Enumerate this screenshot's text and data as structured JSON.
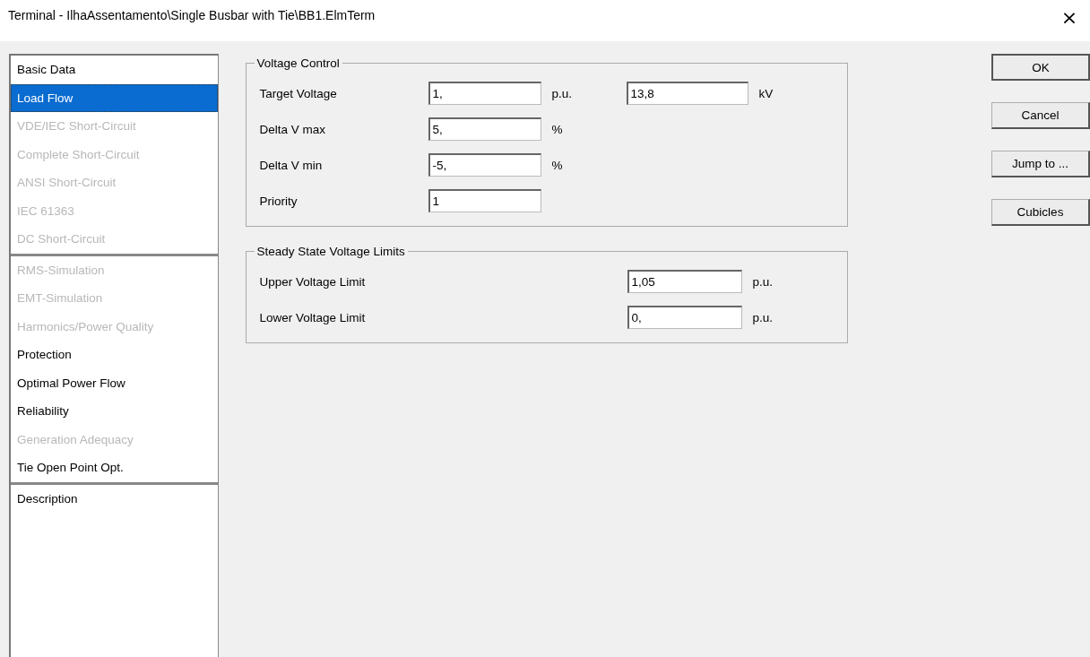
{
  "window": {
    "title": "Terminal - IlhaAssentamento\\Single Busbar with Tie\\BB1.ElmTerm",
    "close": "×"
  },
  "sidebar": {
    "groups": [
      [
        {
          "label": "Basic Data",
          "selected": false,
          "disabled": false
        },
        {
          "label": "Load Flow",
          "selected": true,
          "disabled": false
        },
        {
          "label": "VDE/IEC Short-Circuit",
          "selected": false,
          "disabled": true
        },
        {
          "label": "Complete Short-Circuit",
          "selected": false,
          "disabled": true
        },
        {
          "label": "ANSI Short-Circuit",
          "selected": false,
          "disabled": true
        },
        {
          "label": "IEC 61363",
          "selected": false,
          "disabled": true
        },
        {
          "label": "DC Short-Circuit",
          "selected": false,
          "disabled": true
        }
      ],
      [
        {
          "label": "RMS-Simulation",
          "selected": false,
          "disabled": true
        },
        {
          "label": "EMT-Simulation",
          "selected": false,
          "disabled": true
        },
        {
          "label": "Harmonics/Power Quality",
          "selected": false,
          "disabled": true
        },
        {
          "label": "Protection",
          "selected": false,
          "disabled": false
        },
        {
          "label": "Optimal Power Flow",
          "selected": false,
          "disabled": false
        },
        {
          "label": "Reliability",
          "selected": false,
          "disabled": false
        },
        {
          "label": "Generation Adequacy",
          "selected": false,
          "disabled": true
        },
        {
          "label": "Tie Open Point Opt.",
          "selected": false,
          "disabled": false
        }
      ],
      [
        {
          "label": "Description",
          "selected": false,
          "disabled": false
        }
      ]
    ]
  },
  "groups": [
    {
      "title": "Voltage Control",
      "kind": "control",
      "rows": [
        {
          "label": "Target Voltage",
          "fields": [
            {
              "value": "1,",
              "unit": "p.u."
            },
            {
              "value": "13,8",
              "unit": "kV"
            }
          ]
        },
        {
          "label": "Delta V max",
          "fields": [
            {
              "value": "5,",
              "unit": "%"
            }
          ]
        },
        {
          "label": "Delta V min",
          "fields": [
            {
              "value": "-5,",
              "unit": "%"
            }
          ]
        },
        {
          "label": "Priority",
          "fields": [
            {
              "value": "1"
            }
          ]
        }
      ]
    },
    {
      "title": "Steady State Voltage Limits",
      "kind": "limits",
      "rows": [
        {
          "label": "Upper Voltage Limit",
          "fields": [
            {
              "value": "1,05",
              "unit": "p.u."
            }
          ]
        },
        {
          "label": "Lower Voltage Limit",
          "fields": [
            {
              "value": "0,",
              "unit": "p.u."
            }
          ]
        }
      ]
    }
  ],
  "buttons": [
    {
      "label": "OK",
      "default": true
    },
    {
      "label": "Cancel",
      "default": false
    },
    {
      "label": "Jump to ...",
      "default": false
    },
    {
      "label": "Cubicles",
      "default": false
    }
  ]
}
